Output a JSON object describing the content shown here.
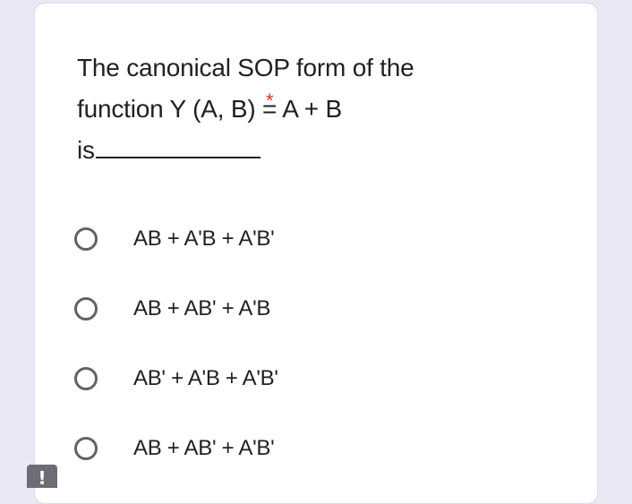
{
  "question": {
    "line1": "The canonical SOP form of the",
    "line2": "function Y (A, B) = A + B",
    "line3_prefix": "is",
    "required_marker": "*"
  },
  "options": [
    {
      "label": "AB + A'B + A'B'",
      "selected": false
    },
    {
      "label": "AB + AB' + A'B",
      "selected": false
    },
    {
      "label": "AB' + A'B + A'B'",
      "selected": false
    },
    {
      "label": "AB + AB' + A'B'",
      "selected": false
    }
  ],
  "colors": {
    "background": "#ece7f4",
    "card": "#ffffff",
    "text": "#202124",
    "required": "#d93025",
    "radio_border": "#5f6368"
  },
  "icons": {
    "bottom_badge": "exclamation-icon",
    "bottom_badge_glyph": "!"
  }
}
